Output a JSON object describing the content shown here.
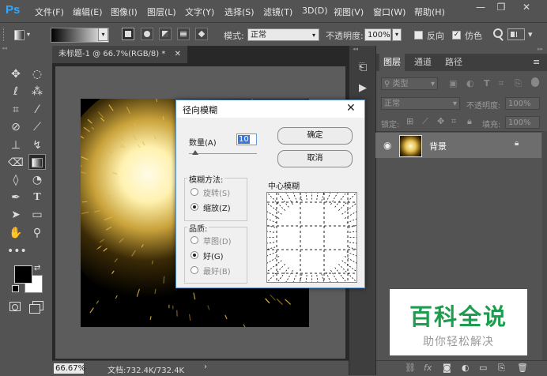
{
  "app": {
    "logo": "Ps"
  },
  "menu": [
    "文件(F)",
    "编辑(E)",
    "图像(I)",
    "图层(L)",
    "文字(Y)",
    "选择(S)",
    "滤镜(T)",
    "3D(D)",
    "视图(V)",
    "窗口(W)",
    "帮助(H)"
  ],
  "window_controls": {
    "minimize": "—",
    "restore": "❐",
    "close": "✕"
  },
  "options": {
    "mode_label": "模式:",
    "mode_value": "正常",
    "opacity_label": "不透明度:",
    "opacity_value": "100%",
    "reverse_label": "反向",
    "dither_label": "仿色"
  },
  "document": {
    "tab_title": "未标题-1 @ 66.7%(RGB/8) *",
    "zoom": "66.67%",
    "doc_info": "文档:732.4K/732.4K"
  },
  "dialog": {
    "title": "径向模糊",
    "amount_label": "数量(A)",
    "amount_value": "10",
    "ok": "确定",
    "cancel": "取消",
    "method_group": "模糊方法:",
    "methods": [
      "旋转(S)",
      "缩放(Z)"
    ],
    "method_selected": 1,
    "quality_group": "品质:",
    "qualities": [
      "草图(D)",
      "好(G)",
      "最好(B)"
    ],
    "quality_selected": 1,
    "center_label": "中心模糊"
  },
  "layers_panel": {
    "tabs": [
      "图层",
      "通道",
      "路径"
    ],
    "filter_kind": "类型",
    "blend_mode": "正常",
    "opacity_label": "不透明度:",
    "opacity_value": "100%",
    "lock_label": "锁定:",
    "fill_label": "填充:",
    "fill_value": "100%",
    "layer_name": "背景"
  },
  "watermark": {
    "title": "百科全说",
    "subtitle": "助你轻松解决"
  }
}
